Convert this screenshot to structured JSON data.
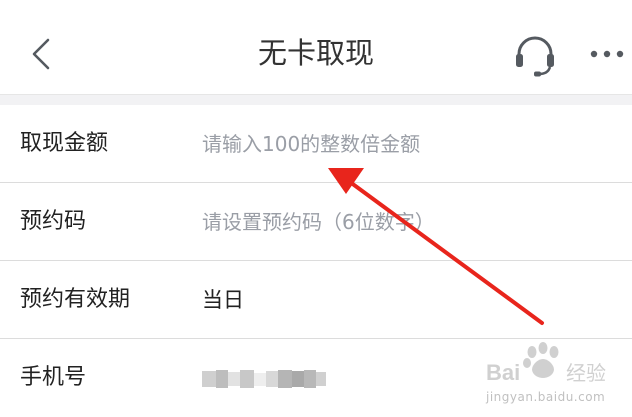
{
  "header": {
    "title": "无卡取现",
    "back_icon": "chevron-left-icon",
    "service_icon": "headset-icon",
    "more_icon": "more-horizontal-icon"
  },
  "form": {
    "rows": [
      {
        "label": "取现金额",
        "placeholder": "请输入100的整数倍金额",
        "value": ""
      },
      {
        "label": "预约码",
        "placeholder": "请设置预约码（6位数字）",
        "value": ""
      },
      {
        "label": "预约有效期",
        "value": "当日"
      },
      {
        "label": "手机号",
        "value_masked": true
      }
    ]
  },
  "watermark": {
    "logo_text": "Bai 经验",
    "url": "jingyan.baidu.com"
  },
  "colors": {
    "annotation_arrow": "#e8251c",
    "placeholder": "#9a9ea6",
    "divider": "#dcdcdc",
    "separator_band": "#f2f2f4"
  }
}
